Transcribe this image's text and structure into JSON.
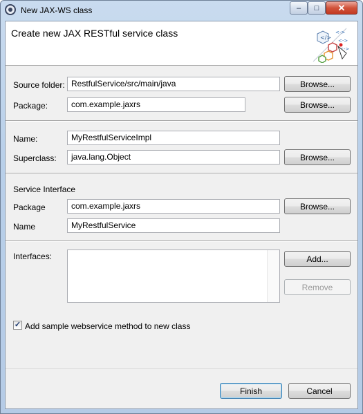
{
  "window": {
    "title": "New JAX-WS class",
    "minimize_label": "‒",
    "maximize_label": "□",
    "close_label": "✕"
  },
  "banner": {
    "title": "Create new JAX RESTful service class"
  },
  "source": {
    "label": "Source folder:",
    "value": "RestfulService/src/main/java",
    "browse_label": "Browse..."
  },
  "package": {
    "label": "Package:",
    "value": "com.example.jaxrs",
    "browse_label": "Browse..."
  },
  "name": {
    "label": "Name:",
    "value": "MyRestfulServiceImpl"
  },
  "superclass": {
    "label": "Superclass:",
    "value": "java.lang.Object",
    "browse_label": "Browse..."
  },
  "service_interface": {
    "heading": "Service Interface",
    "package_label": "Package",
    "package_value": "com.example.jaxrs",
    "browse_label": "Browse...",
    "name_label": "Name",
    "name_value": "MyRestfulService"
  },
  "interfaces": {
    "label": "Interfaces:",
    "add_label": "Add...",
    "remove_label": "Remove"
  },
  "sample_method": {
    "label": "Add sample webservice method to new class",
    "checked": true,
    "check_glyph": "✓"
  },
  "footer": {
    "finish_label": "Finish",
    "cancel_label": "Cancel"
  }
}
